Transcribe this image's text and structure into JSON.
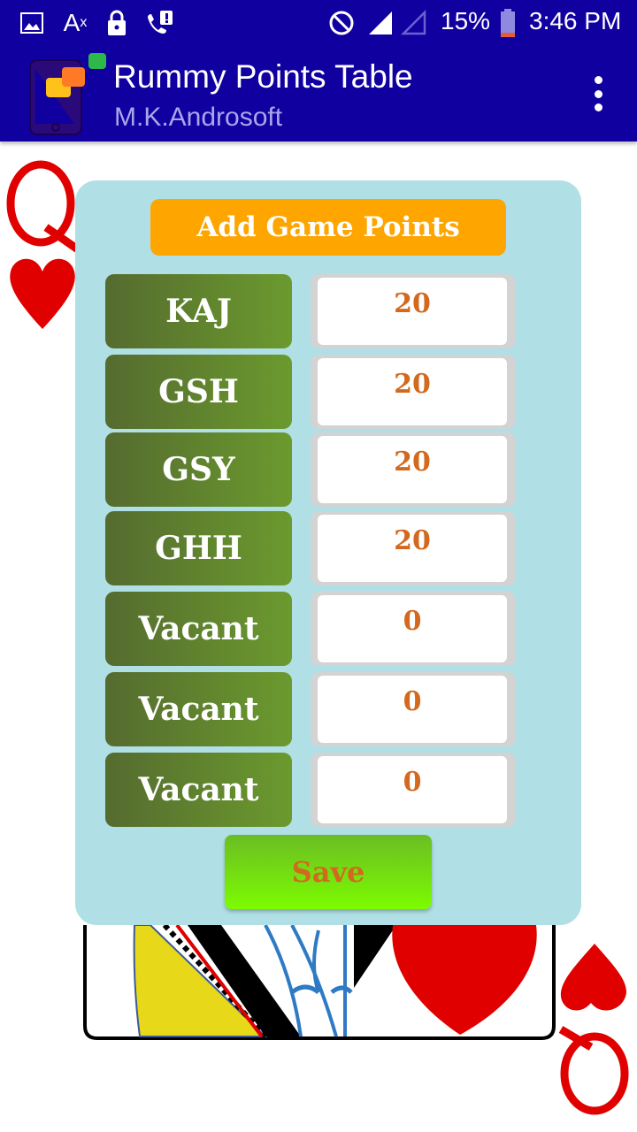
{
  "status_bar": {
    "left_icons": [
      "image-icon",
      "text-format-icon",
      "lock-icon",
      "phone-alert-icon"
    ],
    "right_icons": [
      "do-not-disturb-icon",
      "signal-full-icon",
      "signal-empty-icon"
    ],
    "battery_percent": "15%",
    "battery_level": 0.15,
    "time": "3:46 PM"
  },
  "app_bar": {
    "title": "Rummy Points Table",
    "subtitle": "M.K.Androsoft",
    "menu_icon": "more-vert-icon"
  },
  "dialog": {
    "title": "Add Game Points",
    "rows": [
      {
        "name": "KAJ",
        "points": "20"
      },
      {
        "name": "GSH",
        "points": "20"
      },
      {
        "name": "GSY",
        "points": "20"
      },
      {
        "name": "GHH",
        "points": "20"
      },
      {
        "name": "Vacant",
        "points": "0"
      },
      {
        "name": "Vacant",
        "points": "0"
      },
      {
        "name": "Vacant",
        "points": "0"
      }
    ],
    "save_label": "Save"
  },
  "background": {
    "card": "queen-of-hearts",
    "rank": "Q"
  },
  "colors": {
    "app_bar": "#1100a0",
    "dialog_bg": "#b0e0e6",
    "title_button": "#ffa500",
    "points_text": "#d2691e",
    "card_red": "#e00000"
  }
}
